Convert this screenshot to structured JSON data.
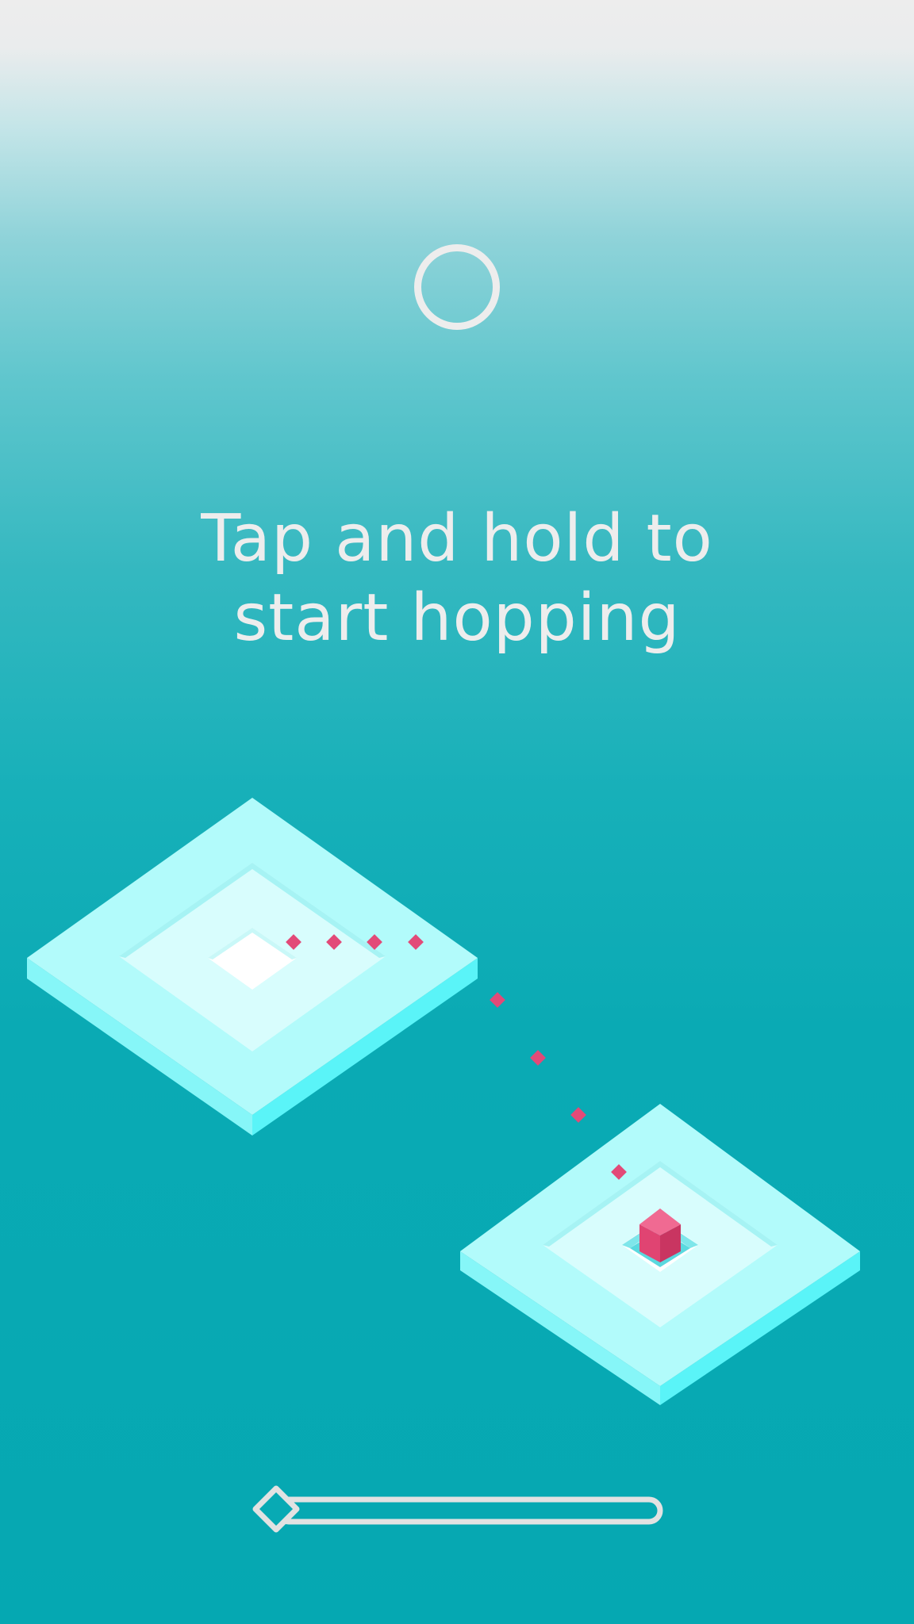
{
  "hud": {
    "score_ring_icon": "ring-icon",
    "progress": 0
  },
  "instruction": {
    "line1": "Tap and hold to",
    "line2": "start hopping"
  },
  "game": {
    "player_color": "#e8507a",
    "trail_color": "#e24a78",
    "platform_top_color": "#b3fbfb",
    "platform_side_color": "#5ff6f9",
    "background_color": "#05a8b2"
  }
}
